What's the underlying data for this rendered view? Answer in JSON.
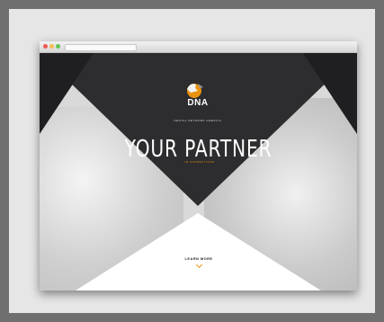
{
  "browser": {
    "window_buttons": [
      "close",
      "minimize",
      "zoom"
    ]
  },
  "site": {
    "logo_text": "DNA",
    "logo_tagline": "DENTAL NETWORK AMERICA",
    "headline": "YOUR PARTNER",
    "sub_tag": "IN CONNECTIONS",
    "cta_label": "LEARN MORE"
  },
  "colors": {
    "dark_panel": "#2d2d2f",
    "accent": "#e8920f",
    "backdrop": "#6f6f6f"
  }
}
